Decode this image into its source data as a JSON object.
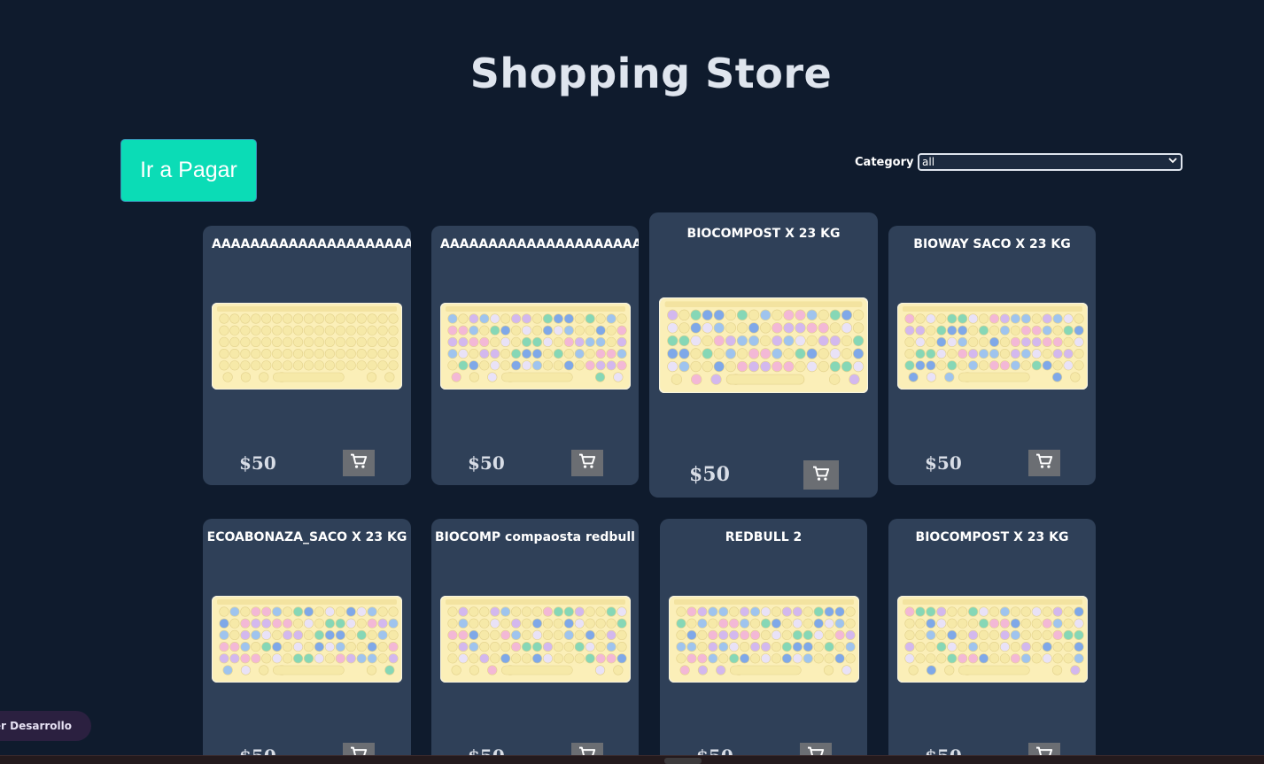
{
  "header": {
    "title": "Shopping Store"
  },
  "actions": {
    "pay_label": "Ir a Pagar"
  },
  "filter": {
    "label": "Category",
    "selected": "all"
  },
  "products": [
    {
      "title": "AAAAAAAAAAAAAAAAAAAAAAAAAAAAAAAAAAAAAAA",
      "price": "$50"
    },
    {
      "title": "AAAAAAAAAAAAAAAAAAAAAAAAAAAAAAAAAAAAAAA",
      "price": "$50"
    },
    {
      "title": "BIOCOMPOST X 23 KG",
      "price": "$50"
    },
    {
      "title": "BIOWAY SACO X 23 KG",
      "price": "$50"
    },
    {
      "title": "ECOABONAZA_SACO X 23 KG",
      "price": "$50"
    },
    {
      "title": "BIOCOMP compaosta redbull",
      "price": "$50"
    },
    {
      "title": "REDBULL 2",
      "price": "$50"
    },
    {
      "title": "BIOCOMPOST X 23 KG",
      "price": "$50"
    }
  ],
  "dev_badge": {
    "label": "per Desarrollo"
  },
  "icons": {
    "cart": "cart-icon",
    "chevron": "chevron-down-icon",
    "product_image": "keyboard-image"
  },
  "colors": {
    "background": "#0f1b2d",
    "card": "#2f4058",
    "accent": "#0bdcb6",
    "cart_button": "#6b6e73"
  }
}
